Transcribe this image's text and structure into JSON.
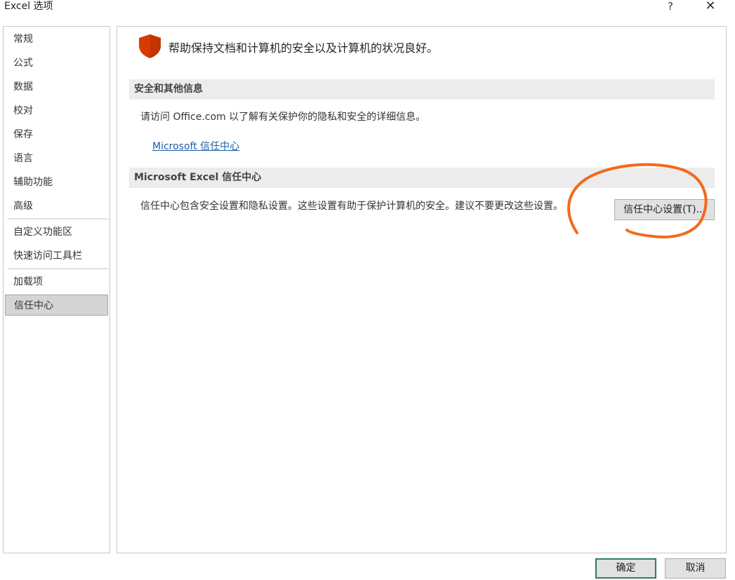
{
  "window": {
    "title": "Excel 选项",
    "help_glyph": "?",
    "close_glyph": "✕"
  },
  "sidebar": {
    "items": [
      {
        "label": "常规"
      },
      {
        "label": "公式"
      },
      {
        "label": "数据"
      },
      {
        "label": "校对"
      },
      {
        "label": "保存"
      },
      {
        "label": "语言"
      },
      {
        "label": "辅助功能"
      },
      {
        "label": "高级"
      },
      {
        "label": "自定义功能区"
      },
      {
        "label": "快速访问工具栏"
      },
      {
        "label": "加载项"
      },
      {
        "label": "信任中心",
        "selected": true
      }
    ]
  },
  "main": {
    "headline": "帮助保持文档和计算机的安全以及计算机的状况良好。",
    "section1": {
      "header": "安全和其他信息",
      "text": "请访问 Office.com 以了解有关保护你的隐私和安全的详细信息。",
      "link": "Microsoft 信任中心"
    },
    "section2": {
      "header": "Microsoft Excel 信任中心",
      "text": "信任中心包含安全设置和隐私设置。这些设置有助于保护计算机的安全。建议不要更改这些设置。",
      "button": "信任中心设置(T)..."
    }
  },
  "footer": {
    "ok": "确定",
    "cancel": "取消"
  },
  "colors": {
    "shield": "#d83b01",
    "annotation": "#f26a1b",
    "link": "#1f5ea8"
  },
  "icons": {
    "shield": "shield-icon",
    "help": "help-icon",
    "close": "close-icon"
  }
}
